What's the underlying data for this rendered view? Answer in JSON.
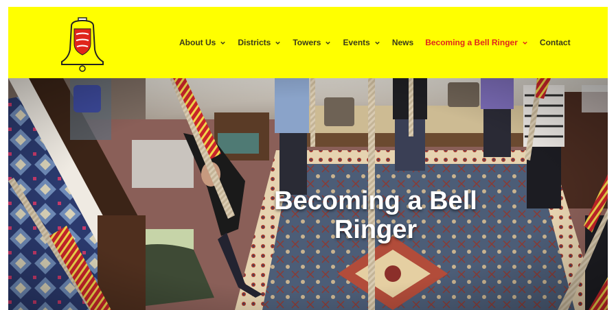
{
  "nav": {
    "items": [
      {
        "label": "About Us",
        "dropdown": true,
        "active": false
      },
      {
        "label": "Districts",
        "dropdown": true,
        "active": false
      },
      {
        "label": "Towers",
        "dropdown": true,
        "active": false
      },
      {
        "label": "Events",
        "dropdown": true,
        "active": false
      },
      {
        "label": "News",
        "dropdown": false,
        "active": false
      },
      {
        "label": "Becoming a Bell Ringer",
        "dropdown": true,
        "active": true
      },
      {
        "label": "Contact",
        "dropdown": false,
        "active": false
      }
    ]
  },
  "hero": {
    "title": "Becoming a Bell Ringer"
  },
  "colors": {
    "header_bg": "#ffff00",
    "nav_text": "#3a3a1a",
    "nav_active": "#e0261b",
    "hero_title": "#ffffff"
  },
  "icons": {
    "logo": "bell-shield-logo-icon",
    "dropdown": "chevron-down-icon"
  }
}
